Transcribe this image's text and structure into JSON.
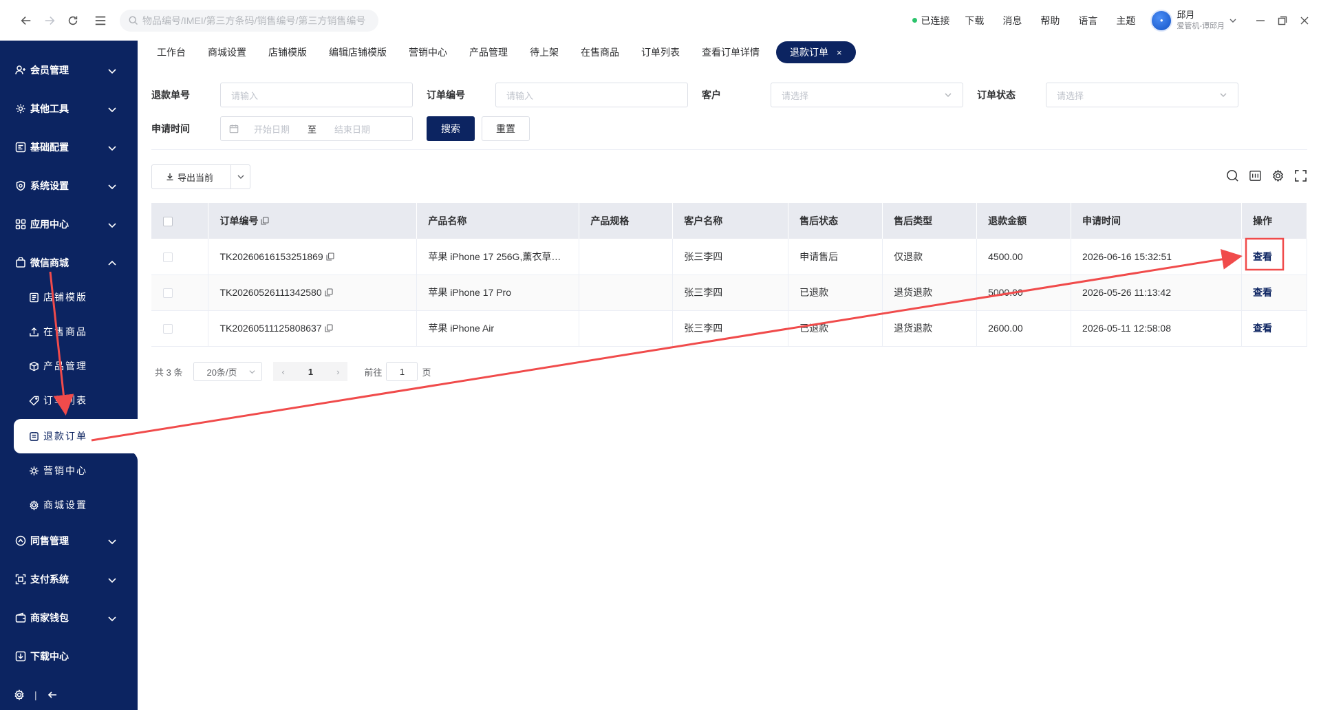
{
  "topbar": {
    "search_placeholder": "物品编号/IMEI/第三方条码/销售编号/第三方销售编号",
    "status": "已连接",
    "links": [
      "下载",
      "消息",
      "帮助",
      "语言",
      "主题"
    ],
    "user_name": "邱月",
    "user_org": "爱管机-谭邱月"
  },
  "sidebar": {
    "groups": [
      {
        "label": "会员管理",
        "icon": "member-icon"
      },
      {
        "label": "其他工具",
        "icon": "tools-icon"
      },
      {
        "label": "基础配置",
        "icon": "config-icon"
      },
      {
        "label": "系统设置",
        "icon": "shield-icon"
      },
      {
        "label": "应用中心",
        "icon": "apps-icon"
      },
      {
        "label": "微信商城",
        "icon": "store-icon"
      },
      {
        "label": "同售管理",
        "icon": "share-icon"
      },
      {
        "label": "支付系统",
        "icon": "payment-icon"
      },
      {
        "label": "商家钱包",
        "icon": "wallet-icon"
      },
      {
        "label": "下载中心",
        "icon": "download-icon"
      }
    ],
    "sub_items": [
      {
        "label": "店铺模版"
      },
      {
        "label": "在售商品"
      },
      {
        "label": "产品管理"
      },
      {
        "label": "订单列表"
      },
      {
        "label": "退款订单"
      },
      {
        "label": "营销中心"
      },
      {
        "label": "商城设置"
      }
    ]
  },
  "tabs": [
    {
      "label": "工作台"
    },
    {
      "label": "商城设置"
    },
    {
      "label": "店铺模版"
    },
    {
      "label": "编辑店铺模版"
    },
    {
      "label": "营销中心"
    },
    {
      "label": "产品管理"
    },
    {
      "label": "待上架"
    },
    {
      "label": "在售商品"
    },
    {
      "label": "订单列表"
    },
    {
      "label": "查看订单详情"
    },
    {
      "label": "退款订单",
      "close": "×"
    }
  ],
  "filters": {
    "refund_no_label": "退款单号",
    "refund_no_placeholder": "请输入",
    "order_no_label": "订单编号",
    "order_no_placeholder": "请输入",
    "customer_label": "客户",
    "customer_placeholder": "请选择",
    "order_status_label": "订单状态",
    "order_status_placeholder": "请选择",
    "apply_time_label": "申请时间",
    "start_placeholder": "开始日期",
    "range_sep": "至",
    "end_placeholder": "结束日期",
    "search_btn": "搜索",
    "reset_btn": "重置"
  },
  "toolbar": {
    "export_label": "导出当前"
  },
  "table": {
    "headers": [
      "订单编号",
      "产品名称",
      "产品规格",
      "客户名称",
      "售后状态",
      "售后类型",
      "退款金额",
      "申请时间",
      "操作"
    ],
    "rows": [
      {
        "order_no": "TK20260616153251869",
        "product": "苹果 iPhone 17 256G,薰衣草…",
        "spec": "",
        "customer": "张三李四",
        "status": "申请售后",
        "type": "仅退款",
        "amount": "4500.00",
        "time": "2026-06-16 15:32:51",
        "action": "查看"
      },
      {
        "order_no": "TK20260526111342580",
        "product": "苹果 iPhone 17 Pro",
        "spec": "",
        "customer": "张三李四",
        "status": "已退款",
        "type": "退货退款",
        "amount": "5000.00",
        "time": "2026-05-26 11:13:42",
        "action": "查看"
      },
      {
        "order_no": "TK20260511125808637",
        "product": "苹果 iPhone Air",
        "spec": "",
        "customer": "张三李四",
        "status": "已退款",
        "type": "退货退款",
        "amount": "2600.00",
        "time": "2026-05-11 12:58:08",
        "action": "查看"
      }
    ]
  },
  "pagination": {
    "total": "共 3 条",
    "page_size": "20条/页",
    "prev": "‹",
    "current": "1",
    "next": "›",
    "goto_label": "前往",
    "goto_value": "1",
    "goto_suffix": "页"
  },
  "colors": {
    "primary": "#0c2461",
    "annotation": "#f04b4b",
    "connected": "#2bc36b"
  }
}
